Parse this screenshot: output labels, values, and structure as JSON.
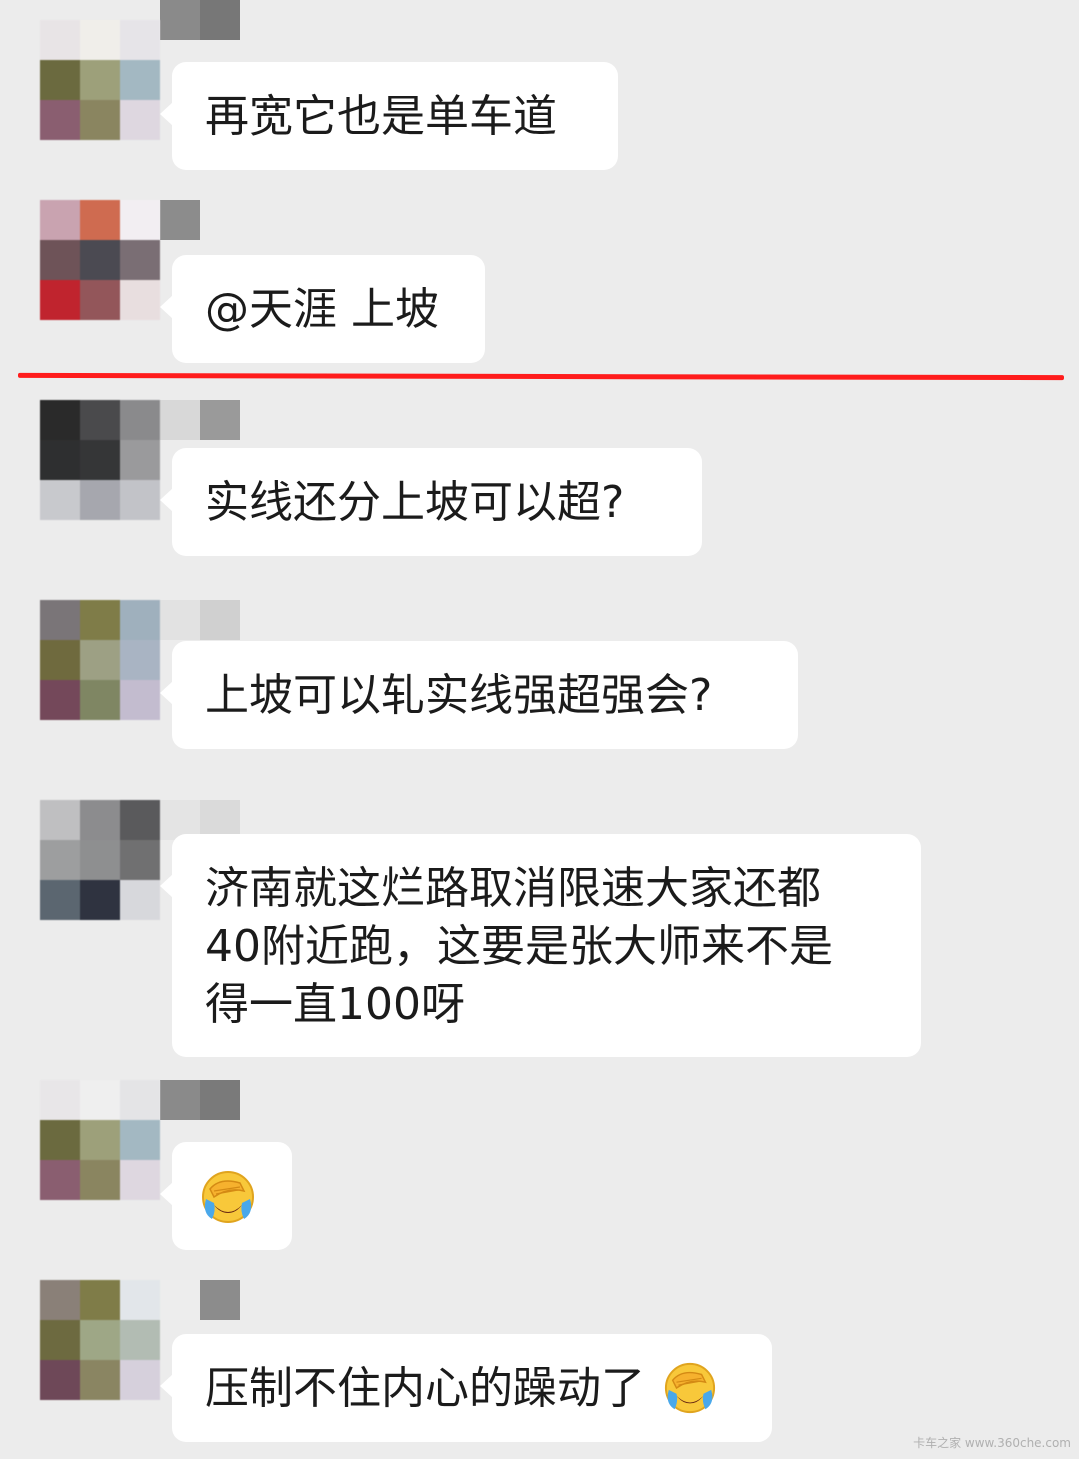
{
  "messages": [
    {
      "text_lines": [
        "再宽它也是单车道"
      ]
    },
    {
      "text_lines": [
        "@天涯 上坡"
      ]
    },
    {
      "text_lines": [
        "实线还分上坡可以超?"
      ]
    },
    {
      "text_lines": [
        "上坡可以轧实线强超强会?"
      ]
    },
    {
      "text_lines": [
        "济南就这烂路取消限速大家还都",
        "40附近跑，这要是张大师来不是",
        "得一直100呀"
      ]
    },
    {
      "text_lines": [
        ""
      ],
      "emoji": "face-palm-crying-emoji"
    },
    {
      "text_lines": [
        "压制不住内心的躁动了"
      ],
      "emoji": "face-palm-crying-emoji"
    }
  ],
  "divider_color": "#ff1c1c",
  "watermark": "卡车之家 www.360che.com"
}
